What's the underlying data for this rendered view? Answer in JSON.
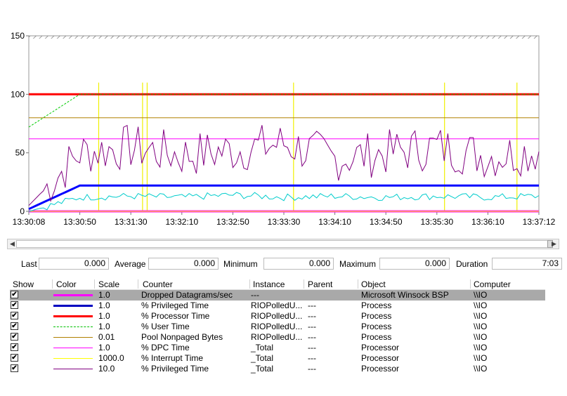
{
  "chart_data": {
    "type": "line",
    "ylim": [
      0,
      150
    ],
    "y_ticks": [
      "0",
      "50",
      "100",
      "150"
    ],
    "x_tick_labels": [
      "13:30:08",
      "13:30:50",
      "13:31:30",
      "13:32:10",
      "13:32:50",
      "13:33:30",
      "13:34:10",
      "13:34:50",
      "13:35:30",
      "13:36:10",
      "13:37:12"
    ],
    "grid": false,
    "series": [
      {
        "name": "Dropped Datagrams/sec",
        "color": "#ff00ff",
        "values": [
          0,
          0,
          0,
          0,
          0,
          0,
          0,
          0,
          0,
          0,
          0
        ]
      },
      {
        "name": "% Privileged Time",
        "color": "#0000ff",
        "values": [
          2,
          22,
          22,
          22,
          22,
          22,
          22,
          22,
          22,
          22,
          22
        ]
      },
      {
        "name": "% Processor Time",
        "color": "#ff0000",
        "values": [
          100,
          100,
          100,
          100,
          100,
          100,
          100,
          100,
          100,
          100,
          100
        ]
      },
      {
        "name": "% User Time",
        "color": "#00cc00",
        "values": [
          72,
          100,
          100,
          100,
          100,
          100,
          100,
          100,
          100,
          100,
          100
        ]
      },
      {
        "name": "Pool Nonpaged Bytes",
        "color": "#b08000",
        "values": [
          80,
          80,
          80,
          80,
          80,
          80,
          80,
          80,
          80,
          80,
          80
        ]
      },
      {
        "name": "% DPC Time",
        "color": "#ff00ff",
        "values": [
          62,
          62,
          62,
          62,
          62,
          62,
          62,
          62,
          62,
          62,
          62
        ]
      },
      {
        "name": "% Interrupt Time",
        "color": "#ffff00",
        "values": [
          0,
          0,
          0,
          0,
          0,
          0,
          0,
          0,
          0,
          0,
          0
        ]
      },
      {
        "name": "% Privileged Time",
        "color": "#800080",
        "values": [
          5,
          50,
          55,
          48,
          52,
          58,
          45,
          50,
          55,
          47,
          52
        ]
      },
      {
        "name": "Dropped Datagrams/sec",
        "color": "#00cccc",
        "values": [
          0,
          12,
          13,
          12,
          14,
          12,
          13,
          12,
          13,
          12,
          13
        ]
      }
    ]
  },
  "stats": {
    "last_label": "Last",
    "last": "0.000",
    "avg_label": "Average",
    "avg": "0.000",
    "min_label": "Minimum",
    "min": "0.000",
    "max_label": "Maximum",
    "max": "0.000",
    "dur_label": "Duration",
    "dur": "7:03"
  },
  "legend": {
    "headers": [
      "Show",
      "Color",
      "Scale",
      "Counter",
      "Instance",
      "Parent",
      "Object",
      "Computer"
    ],
    "rows": [
      {
        "color": "#ff00ff",
        "width": 3,
        "dash": false,
        "scale": "1.0",
        "counter": "Dropped Datagrams/sec",
        "instance": "---",
        "parent": "",
        "object": "Microsoft Winsock BSP",
        "computer": "\\\\IO",
        "selected": true
      },
      {
        "color": "#0000c0",
        "width": 3,
        "dash": false,
        "scale": "1.0",
        "counter": "% Privileged Time",
        "instance": "RIOPolledU...",
        "parent": "---",
        "object": "Process",
        "computer": "\\\\IO",
        "selected": false
      },
      {
        "color": "#ff0000",
        "width": 3,
        "dash": false,
        "scale": "1.0",
        "counter": "% Processor Time",
        "instance": "RIOPolledU...",
        "parent": "---",
        "object": "Process",
        "computer": "\\\\IO",
        "selected": false
      },
      {
        "color": "#00c000",
        "width": 1,
        "dash": true,
        "scale": "1.0",
        "counter": "% User Time",
        "instance": "RIOPolledU...",
        "parent": "---",
        "object": "Process",
        "computer": "\\\\IO",
        "selected": false
      },
      {
        "color": "#b08000",
        "width": 1,
        "dash": false,
        "scale": "0.01",
        "counter": "Pool Nonpaged Bytes",
        "instance": "RIOPolledU...",
        "parent": "---",
        "object": "Process",
        "computer": "\\\\IO",
        "selected": false
      },
      {
        "color": "#ff00ff",
        "width": 1,
        "dash": false,
        "scale": "1.0",
        "counter": "% DPC Time",
        "instance": "_Total",
        "parent": "---",
        "object": "Processor",
        "computer": "\\\\IO",
        "selected": false
      },
      {
        "color": "#ffff00",
        "width": 1,
        "dash": false,
        "scale": "1000.0",
        "counter": "% Interrupt Time",
        "instance": "_Total",
        "parent": "---",
        "object": "Processor",
        "computer": "\\\\IO",
        "selected": false
      },
      {
        "color": "#800080",
        "width": 1,
        "dash": false,
        "scale": "10.0",
        "counter": "% Privileged Time",
        "instance": "_Total",
        "parent": "---",
        "object": "Processor",
        "computer": "\\\\IO",
        "selected": false
      }
    ]
  }
}
